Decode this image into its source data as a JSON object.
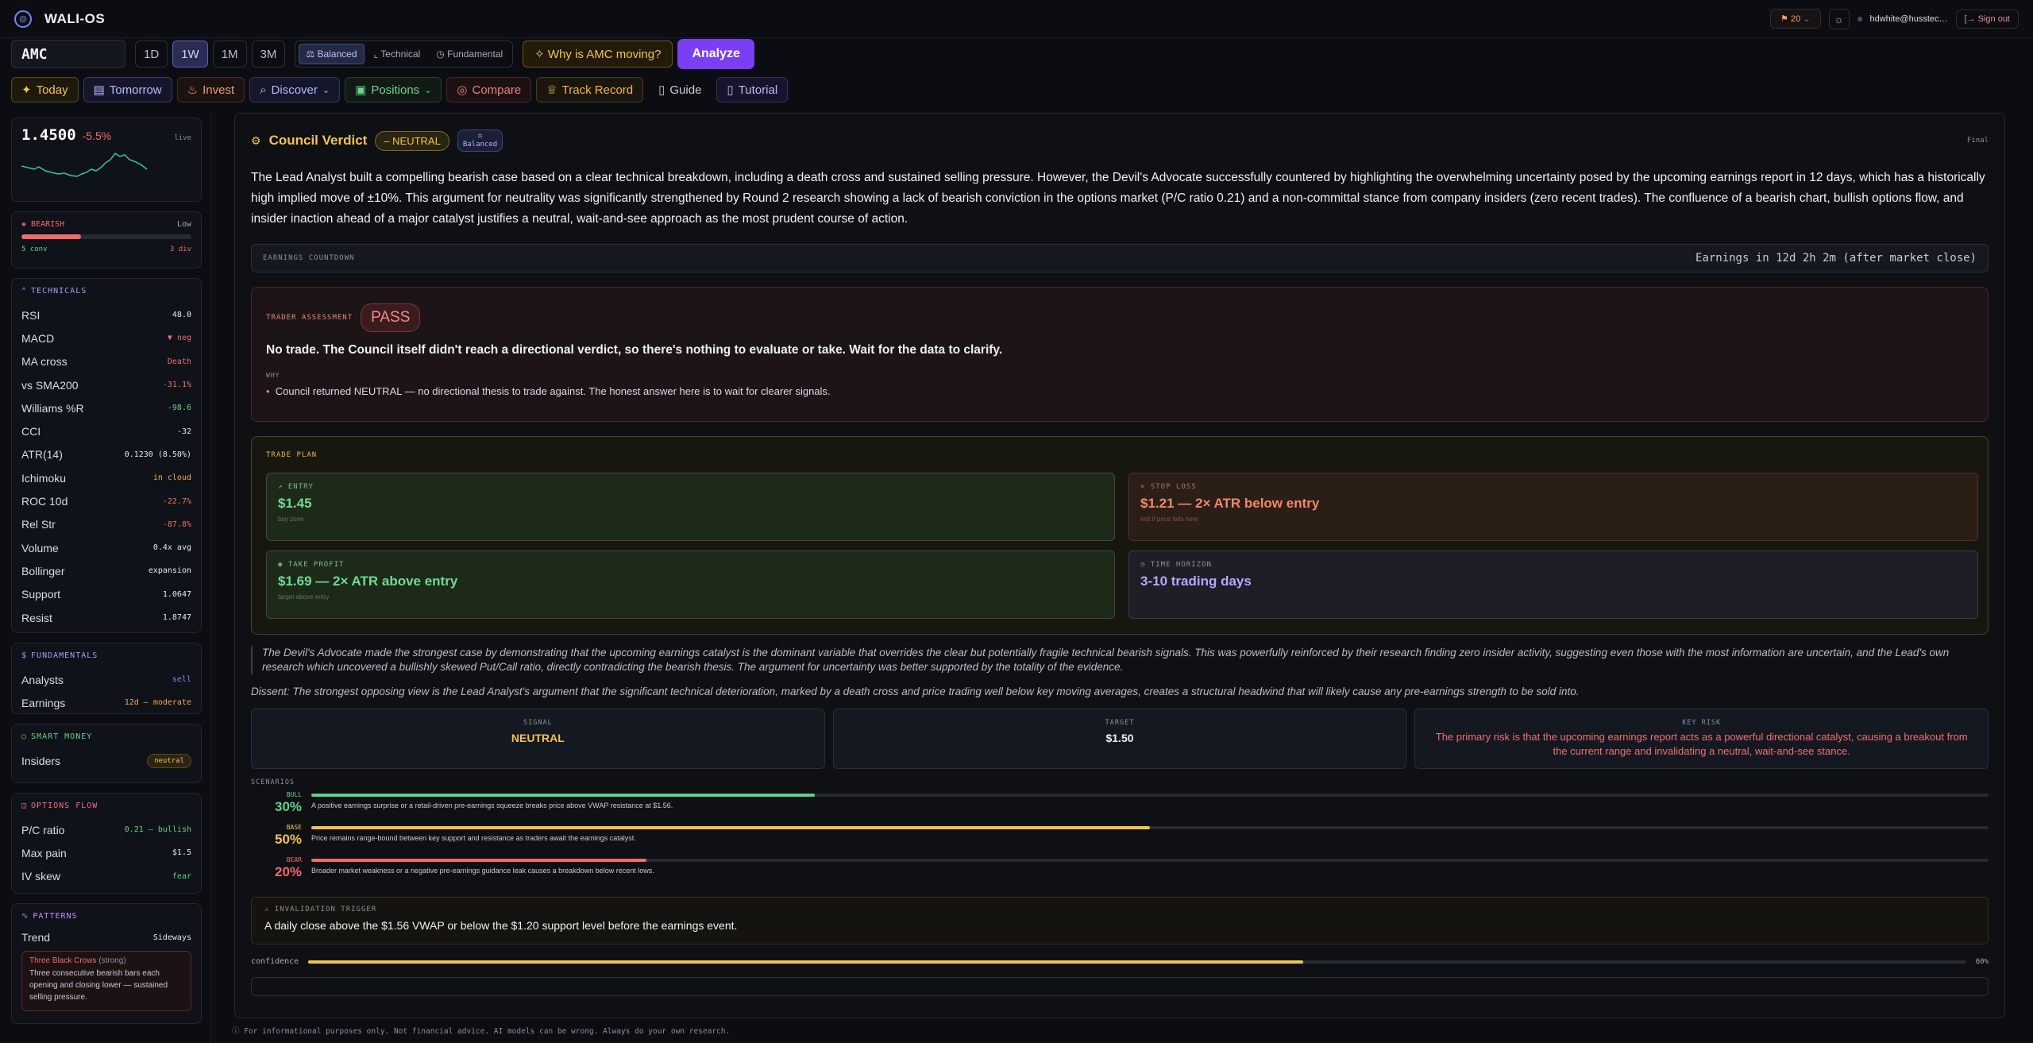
{
  "header": {
    "brand": "WALI-OS",
    "credits": "20",
    "user": "hdwhite@husstec…",
    "signout": "Sign out"
  },
  "toolbar": {
    "ticker": "AMC",
    "ranges": [
      "1D",
      "1W",
      "1M",
      "3M"
    ],
    "active_range": "1W",
    "modes": [
      "Balanced",
      "Technical",
      "Fundamental"
    ],
    "why": "Why is AMC moving?",
    "analyze": "Analyze"
  },
  "nav": [
    "Today",
    "Tomorrow",
    "Invest",
    "Discover",
    "Positions",
    "Compare",
    "Track Record",
    "Guide",
    "Tutorial"
  ],
  "sidebar": {
    "price": "1.4500",
    "change": "-5.5%",
    "live": "live",
    "sentiment": {
      "label": "BEARISH",
      "level": "Low",
      "bar": 0.35,
      "left": "5 conv",
      "right": "3 div"
    },
    "technicals_title": "TECHNICALS",
    "technicals": [
      [
        "RSI",
        "48.0"
      ],
      [
        "MACD",
        "▼ neg"
      ],
      [
        "MA cross",
        "Death"
      ],
      [
        "vs SMA200",
        "-31.1%"
      ],
      [
        "Williams %R",
        "-98.6"
      ],
      [
        "CCI",
        "-32"
      ],
      [
        "ATR(14)",
        "0.1230 (8.50%)"
      ],
      [
        "Ichimoku",
        "in cloud"
      ],
      [
        "ROC 10d",
        "-22.7%"
      ],
      [
        "Rel Str",
        "-87.8%"
      ],
      [
        "Volume",
        "0.4x avg"
      ],
      [
        "Bollinger",
        "expansion"
      ],
      [
        "Support",
        "1.0647"
      ],
      [
        "Resist",
        "1.8747"
      ]
    ],
    "fundamentals_title": "FUNDAMENTALS",
    "fundamentals": [
      [
        "Analysts",
        "sell"
      ],
      [
        "Earnings",
        "12d — moderate"
      ]
    ],
    "smart_title": "SMART MONEY",
    "insiders_label": "Insiders",
    "insiders": "neutral",
    "options_title": "OPTIONS FLOW",
    "options": [
      [
        "P/C ratio",
        "0.21 — bullish"
      ],
      [
        "Max pain",
        "$1.5"
      ],
      [
        "IV skew",
        "fear"
      ]
    ],
    "patterns_title": "PATTERNS",
    "trend_label": "Trend",
    "trend": "Sideways",
    "pattern_name": "Three Black Crows",
    "pattern_strength": "(strong)",
    "pattern_desc": "Three consecutive bearish bars each opening and closing lower — sustained selling pressure."
  },
  "verdict": {
    "title": "Council Verdict",
    "stance": "NEUTRAL",
    "mode": "Balanced",
    "status": "Final",
    "summary": "The Lead Analyst built a compelling bearish case based on a clear technical breakdown, including a death cross and sustained selling pressure. However, the Devil's Advocate successfully countered by highlighting the overwhelming uncertainty posed by the upcoming earnings report in 12 days, which has a historically high implied move of ±10%. This argument for neutrality was significantly strengthened by Round 2 research showing a lack of bearish conviction in the options market (P/C ratio 0.21) and a non-committal stance from company insiders (zero recent trades). The confluence of a bearish chart, bullish options flow, and insider inaction ahead of a major catalyst justifies a neutral, wait-and-see approach as the most prudent course of action.",
    "countdown_label": "EARNINGS COUNTDOWN",
    "countdown": "Earnings in 12d 2h 2m (after market close)",
    "assessment_label": "TRADER ASSESSMENT",
    "assessment": "PASS",
    "assessment_text": "No trade. The Council itself didn't reach a directional verdict, so there's nothing to evaluate or take. Wait for the data to clarify.",
    "why_label": "WHY",
    "why_item": "Council returned NEUTRAL — no directional thesis to trade against. The honest answer here is to wait for clearer signals.",
    "plan_label": "TRADE PLAN",
    "entry": {
      "label": "ENTRY",
      "value": "$1.45",
      "sub": "buy zone"
    },
    "stop": {
      "label": "STOP LOSS",
      "value": "$1.21 — 2× ATR below entry",
      "sub": "exit if price falls here"
    },
    "tp": {
      "label": "TAKE PROFIT",
      "value": "$1.69 — 2× ATR above entry",
      "sub": "target above entry"
    },
    "horizon": {
      "label": "TIME HORIZON",
      "value": "3-10 trading days"
    },
    "quote": "The Devil's Advocate made the strongest case by demonstrating that the upcoming earnings catalyst is the dominant variable that overrides the clear but potentially fragile technical bearish signals. This was powerfully reinforced by their research finding zero insider activity, suggesting even those with the most information are uncertain, and the Lead's own research which uncovered a bullishly skewed Put/Call ratio, directly contradicting the bearish thesis. The argument for uncertainty was better supported by the totality of the evidence.",
    "dissent": "Dissent: The strongest opposing view is the Lead Analyst's argument that the significant technical deterioration, marked by a death cross and price trading well below key moving averages, creates a structural headwind that will likely cause any pre-earnings strength to be sold into.",
    "signal_label": "SIGNAL",
    "signal": "NEUTRAL",
    "target_label": "TARGET",
    "target": "$1.50",
    "risk_label": "KEY RISK",
    "risk": "The primary risk is that the upcoming earnings report acts as a powerful directional catalyst, causing a breakout from the current range and invalidating a neutral, wait-and-see stance.",
    "scenarios_label": "SCENARIOS",
    "scenarios": [
      {
        "name": "BULL",
        "pct": "30%",
        "fill": 0.3,
        "text": "A positive earnings surprise or a retail-driven pre-earnings squeeze breaks price above VWAP resistance at $1.56."
      },
      {
        "name": "BASE",
        "pct": "50%",
        "fill": 0.5,
        "text": "Price remains range-bound between key support and resistance as traders await the earnings catalyst."
      },
      {
        "name": "BEAR",
        "pct": "20%",
        "fill": 0.2,
        "text": "Broader market weakness or a negative pre-earnings guidance leak causes a breakdown below recent lows."
      }
    ],
    "trigger_label": "INVALIDATION TRIGGER",
    "trigger": "A daily close above the $1.56 VWAP or below the $1.20 support level before the earnings event.",
    "confidence_label": "confidence",
    "confidence": "60%",
    "confidence_fill": 0.6
  },
  "footer": "For informational purposes only. Not financial advice. AI models can be wrong. Always do your own research.",
  "colors": {
    "accent": "#7a3ff2",
    "bearish": "#f06b6b",
    "bullish": "#5fd18a",
    "gold": "#f3c34e"
  }
}
